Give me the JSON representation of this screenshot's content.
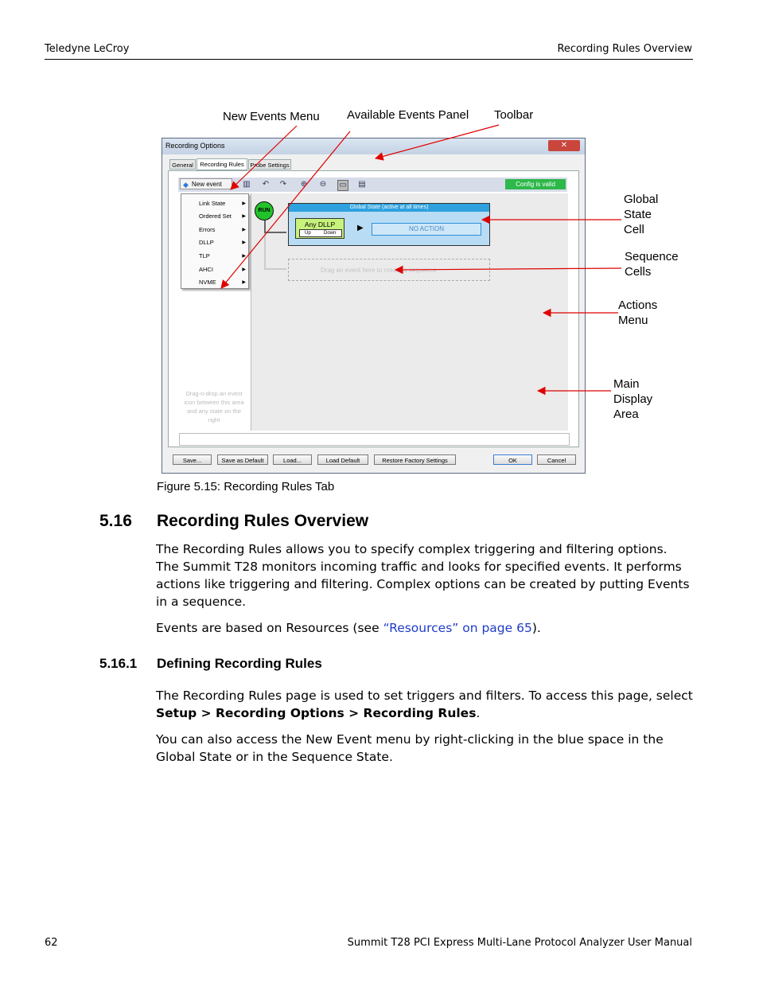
{
  "header": {
    "left": "Teledyne LeCroy",
    "right": "Recording Rules Overview"
  },
  "callouts": {
    "new_events_menu": "New Events Menu",
    "available_events_panel": "Available Events Panel",
    "toolbar": "Toolbar",
    "global_state_cell": [
      "Global",
      "State",
      "Cell"
    ],
    "sequence_cells": [
      "Sequence",
      "Cells"
    ],
    "actions_menu": [
      "Actions",
      "Menu"
    ],
    "main_display_area": [
      "Main",
      "Display",
      "Area"
    ]
  },
  "dialog": {
    "title": "Recording Options",
    "close": "✕",
    "tabs": [
      "General",
      "Recording Rules",
      "Probe Settings"
    ],
    "new_event_label": "New event",
    "config_status": "Config is valid",
    "menu_items": [
      "Link State",
      "Ordered Set",
      "Errors",
      "DLLP",
      "TLP",
      "AHCI",
      "NVME"
    ],
    "menu_arrow": "▶",
    "hint_text": "Drag-n-drop an event icon between this area and any state on the right",
    "run_label": "RUN",
    "global_state_title": "Global State (active at all times)",
    "any_dllp": "Any DLLP",
    "up_label": "Up",
    "down_label": "Down",
    "no_action": "NO ACTION",
    "sequence_hint": "Drag an event here to create a sequence",
    "buttons": [
      "Save...",
      "Save as Default",
      "Load...",
      "Load Default",
      "Restore Factory Settings",
      "OK",
      "Cancel"
    ]
  },
  "figure_caption": "Figure 5.15:  Recording Rules Tab",
  "section": {
    "number": "5.16",
    "title": "Recording Rules Overview"
  },
  "para1": "The Recording Rules allows you to specify complex triggering and filtering options. The Summit T28 monitors incoming traffic and looks for specified events. It performs actions like triggering and filtering. Complex options can be created by putting Events in a sequence.",
  "para2": {
    "before": "Events are based on Resources (see ",
    "link": "“Resources” on page 65",
    "after": ")."
  },
  "subsection": {
    "number": "5.16.1",
    "title": "Defining Recording Rules"
  },
  "para3": {
    "text": "The Recording Rules page is used to set triggers and filters. To access this page, select ",
    "bold": "Setup > Recording Options > Recording Rules",
    "end": "."
  },
  "para4": "You can also access the New Event menu by right-clicking in the blue space in the Global State or in the Sequence State.",
  "footer": {
    "page": "62",
    "title": "Summit T28 PCI Express Multi-Lane Protocol Analyzer User Manual"
  },
  "colors": {
    "arrow": "#e00000",
    "link": "#1f3cc7",
    "valid": "#2db84a",
    "global_state_bar": "#2ea1de",
    "event": "#c7f27b"
  }
}
